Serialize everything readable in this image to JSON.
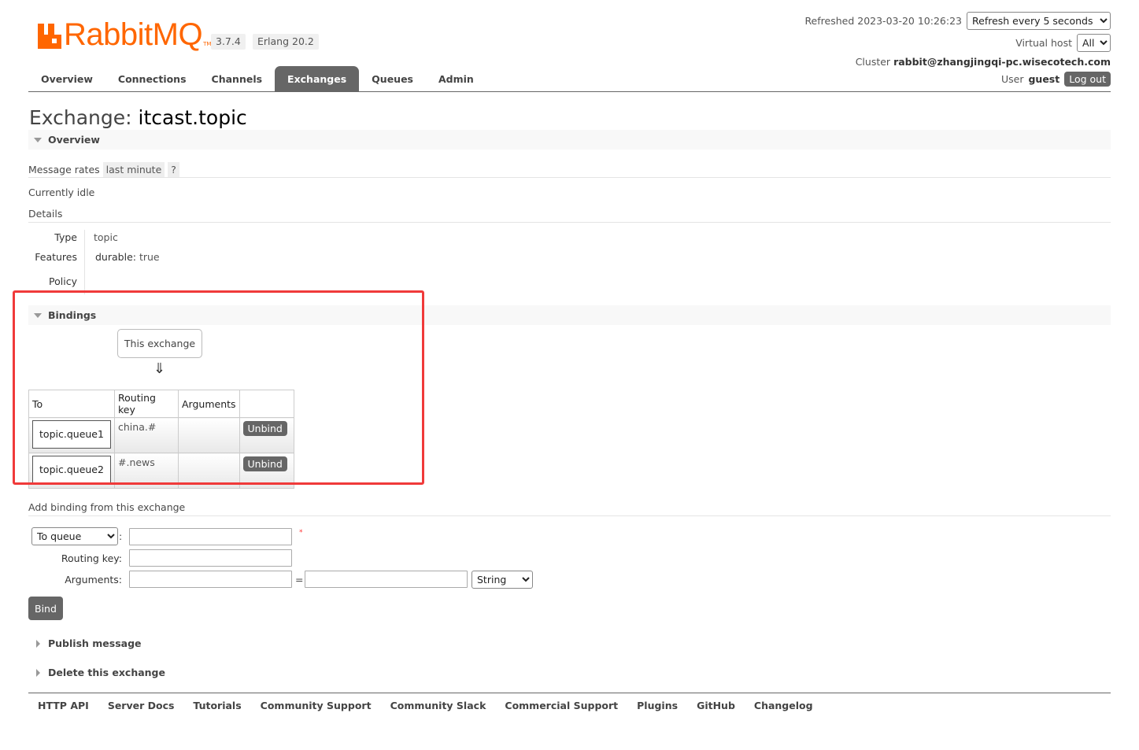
{
  "brand": {
    "word": "Rabbit",
    "word2": "MQ",
    "tm": "TM"
  },
  "versions": {
    "rabbitmq": "3.7.4",
    "erlang": "Erlang 20.2"
  },
  "header": {
    "refreshed_label": "Refreshed 2023-03-20 10:26:23",
    "refresh_option": "Refresh every 5 seconds",
    "vhost_label": "Virtual host",
    "vhost_value": "All",
    "cluster_label": "Cluster",
    "cluster_value": "rabbit@zhangjingqi-pc.wisecotech.com",
    "user_label": "User",
    "user_value": "guest",
    "logout_label": "Log out"
  },
  "nav": [
    "Overview",
    "Connections",
    "Channels",
    "Exchanges",
    "Queues",
    "Admin"
  ],
  "page": {
    "title_prefix": "Exchange:",
    "title_name": "itcast.topic"
  },
  "overview": {
    "heading": "Overview",
    "rates_label": "Message rates",
    "rates_period": "last minute",
    "help": "?",
    "idle": "Currently idle",
    "details_heading": "Details",
    "type_label": "Type",
    "type_value": "topic",
    "features_label": "Features",
    "features_key": "durable:",
    "features_value": "true",
    "policy_label": "Policy"
  },
  "bindings": {
    "heading": "Bindings",
    "source": "This exchange",
    "arrow": "⇓",
    "columns": [
      "To",
      "Routing key",
      "Arguments",
      ""
    ],
    "rows": [
      {
        "to": "topic.queue1",
        "routing_key": "china.#",
        "arguments": "",
        "action": "Unbind"
      },
      {
        "to": "topic.queue2",
        "routing_key": "#.news",
        "arguments": "",
        "action": "Unbind"
      }
    ]
  },
  "add_binding": {
    "heading": "Add binding from this exchange",
    "dest_type": "To queue",
    "colon": ":",
    "required_mark": "*",
    "routing_key_label": "Routing key:",
    "arguments_label": "Arguments:",
    "equals": "=",
    "arg_type": "String",
    "bind_label": "Bind"
  },
  "collapsed_sections": {
    "publish": "Publish message",
    "delete": "Delete this exchange"
  },
  "footer": [
    "HTTP API",
    "Server Docs",
    "Tutorials",
    "Community Support",
    "Community Slack",
    "Commercial Support",
    "Plugins",
    "GitHub",
    "Changelog"
  ],
  "colors": {
    "brand": "#ff6600",
    "highlight_frame": "#f03a3a",
    "active_tab": "#666666"
  }
}
